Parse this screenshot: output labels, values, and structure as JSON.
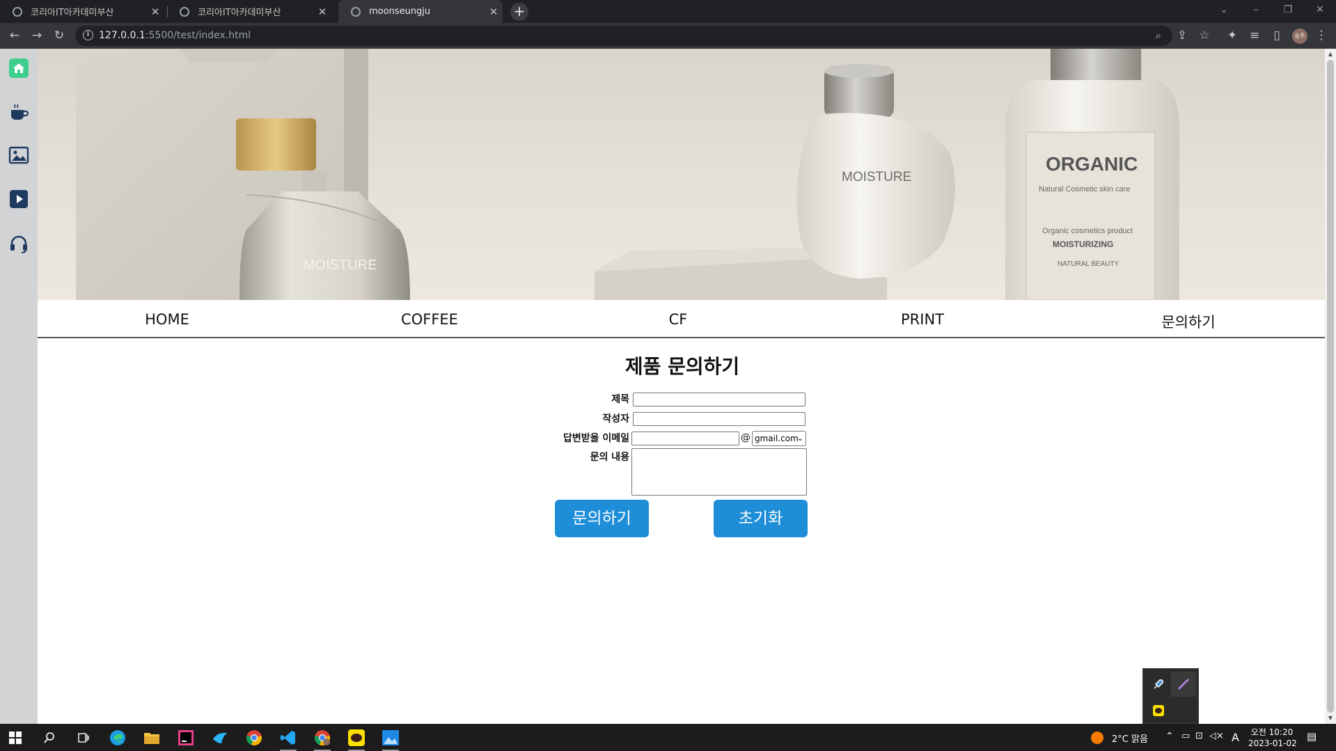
{
  "browser": {
    "tabs": [
      {
        "title": "코리아IT아카데미부산",
        "active": false
      },
      {
        "title": "코리아IT아카데미부산",
        "active": false
      },
      {
        "title": "moonseungju",
        "active": true
      }
    ],
    "url_host": "127.0.0.1",
    "url_rest": ":5500/test/index.html",
    "profile_initials": "승주"
  },
  "sidebar": {
    "items": [
      {
        "icon": "home-icon",
        "color": "#3ecf8e"
      },
      {
        "icon": "coffee-icon",
        "color": "#1f3a5f"
      },
      {
        "icon": "image-icon",
        "color": "#1f3a5f"
      },
      {
        "icon": "play-icon",
        "color": "#1f3a5f"
      },
      {
        "icon": "headset-icon",
        "color": "#1f3a5f"
      }
    ]
  },
  "hero": {
    "bottle_labels": [
      "MOISTURE",
      "MOISTURE",
      "ORGANIC",
      "Natural Cosmetic skin care",
      "Organic cosmetics product",
      "MOISTURIZING",
      "NATURAL BEAUTY"
    ]
  },
  "nav": {
    "items": [
      "HOME",
      "COFFEE",
      "CF",
      "PRINT",
      "문의하기"
    ]
  },
  "form": {
    "title": "제품 문의하기",
    "labels": {
      "subject": "제목",
      "author": "작성자",
      "email": "답변받을 이메일",
      "content": "문의 내용"
    },
    "at_sign": "@",
    "email_domain": "gmail.com",
    "submit_label": "문의하기",
    "reset_label": "초기화",
    "button_color": "#1e8ed8"
  },
  "taskbar": {
    "weather": "2°C  맑음",
    "ime": "A",
    "time_line1": "오전 10:20",
    "time_line2": "2023-01-02"
  }
}
